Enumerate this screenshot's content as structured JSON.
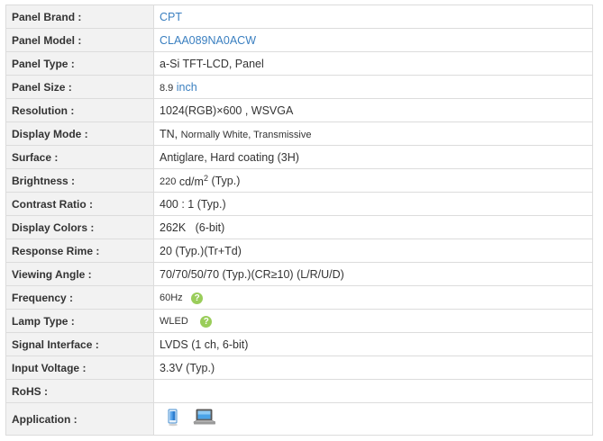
{
  "rows": [
    {
      "label": "Panel Brand :",
      "value": "CPT"
    },
    {
      "label": "Panel Model :",
      "value": "CLAA089NA0ACW"
    },
    {
      "label": "Panel Type :",
      "value": "a-Si TFT-LCD, Panel"
    },
    {
      "label": "Panel Size :",
      "value": "8.9",
      "unit": "inch"
    },
    {
      "label": "Resolution :",
      "value": "1024(RGB)×600 ,  WSVGA"
    },
    {
      "label": "Display Mode :",
      "value_main": "TN,",
      "value_rest": "Normally White, Transmissive"
    },
    {
      "label": "Surface :",
      "value": "Antiglare, Hard coating (3H)"
    },
    {
      "label": "Brightness :",
      "value_num": "220",
      "value_unit": "cd/m",
      "value_sup": "2",
      "value_tail": "(Typ.)"
    },
    {
      "label": "Contrast Ratio :",
      "value": "400 : 1 (Typ.)"
    },
    {
      "label": "Display Colors :",
      "value": "262K   (6-bit)"
    },
    {
      "label": "Response Rime :",
      "value": "20 (Typ.)(Tr+Td)"
    },
    {
      "label": "Viewing Angle :",
      "value": "70/70/50/70 (Typ.)(CR≥10) (L/R/U/D)"
    },
    {
      "label": "Frequency :",
      "value": "60Hz"
    },
    {
      "label": "Lamp Type :",
      "value": "WLED"
    },
    {
      "label": "Signal Interface :",
      "value": "LVDS (1 ch, 6-bit)"
    },
    {
      "label": "Input Voltage :",
      "value": "3.3V (Typ.)"
    },
    {
      "label": "RoHS :",
      "value": ""
    },
    {
      "label": "Application :",
      "icons": [
        "tablet-icon",
        "laptop-icon"
      ]
    }
  ],
  "help_icon_glyph": "?"
}
